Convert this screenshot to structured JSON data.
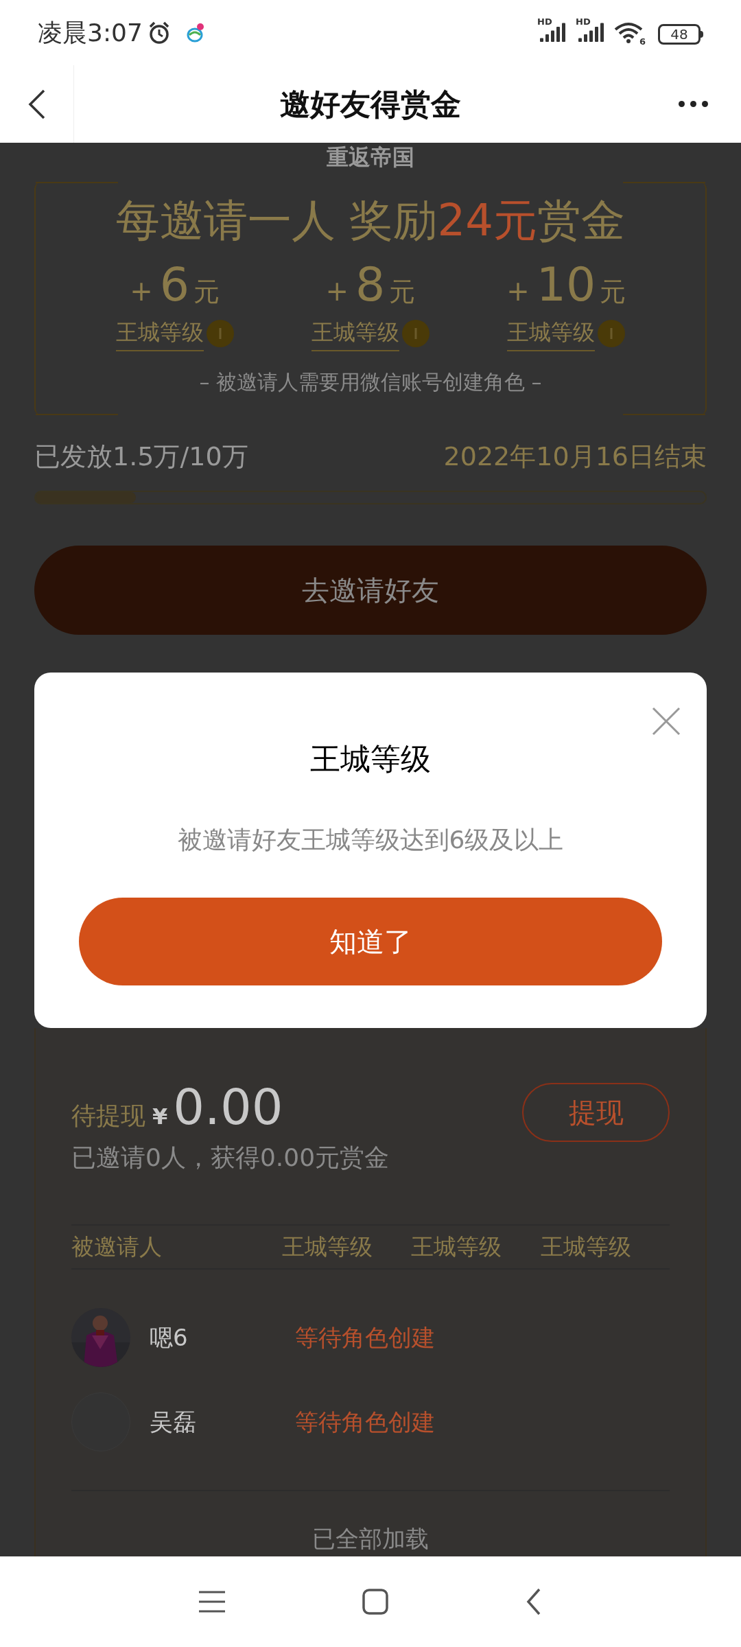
{
  "status_bar": {
    "time": "凌晨3:07",
    "signals": [
      {
        "label": "HD"
      },
      {
        "label": "HD"
      }
    ],
    "wifi_label": "6",
    "battery": "48"
  },
  "nav": {
    "title": "邀好友得赏金"
  },
  "game_title": "重返帝国",
  "banner": {
    "headline": {
      "before": "每邀请一人 奖励",
      "highlight": "24元",
      "after": "赏金"
    },
    "rewards": [
      {
        "plus": "+",
        "amount": "6",
        "unit": "元",
        "label": "王城等级"
      },
      {
        "plus": "+",
        "amount": "8",
        "unit": "元",
        "label": "王城等级"
      },
      {
        "plus": "+",
        "amount": "10",
        "unit": "元",
        "label": "王城等级"
      }
    ],
    "note": "– 被邀请人需要用微信账号创建角色 –"
  },
  "progress": {
    "issued": "已发放1.5万/10万",
    "deadline": "2022年10月16日结束",
    "level": 0.15
  },
  "invite_button": "去邀请好友",
  "modal": {
    "title": "王城等级",
    "message": "被邀请好友王城等级达到6级及以上",
    "confirm": "知道了"
  },
  "wallet": {
    "label": "待提现",
    "currency": "¥",
    "amount": "0.00",
    "summary": "已邀请0人，获得0.00元赏金",
    "withdraw": "提现"
  },
  "table": {
    "columns": [
      "被邀请人",
      "王城等级",
      "王城等级",
      "王城等级"
    ],
    "rows": [
      {
        "name": "嗯6",
        "status": "等待角色创建"
      },
      {
        "name": "吴磊",
        "status": "等待角色创建"
      }
    ],
    "footer": "已全部加载"
  }
}
